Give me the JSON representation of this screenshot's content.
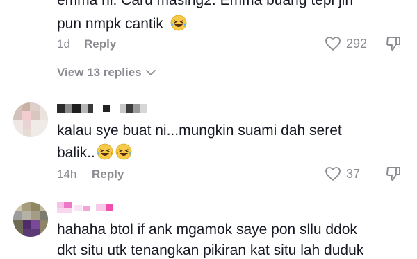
{
  "comment1": {
    "text_partial_top": "emma ni. Caru masing2. Emma buang tepi jin",
    "text_line2": "pun nmpk cantik",
    "time": "1d",
    "reply_label": "Reply",
    "like_count": "292",
    "view_replies": "View 13 replies"
  },
  "comment2": {
    "username": "blurred username",
    "text_line1": "kalau sye buat ni...mungkin suami dah seret",
    "text_line2": "balik..",
    "time": "14h",
    "reply_label": "Reply",
    "like_count": "37"
  },
  "comment3": {
    "username": "blurred username",
    "text_line1": "hahaha btol if ank mgamok saye pon sllu ddok",
    "text_partial_bottom": "dkt situ utk tenangkan pikiran kat situ lah duduk"
  },
  "colors": {
    "text": "#161823",
    "muted": "#8a8b91",
    "emoji_face": "#f7c948"
  },
  "icons": [
    "heart-icon",
    "dislike-icon",
    "chevron-down-icon",
    "laughing-emoji"
  ]
}
